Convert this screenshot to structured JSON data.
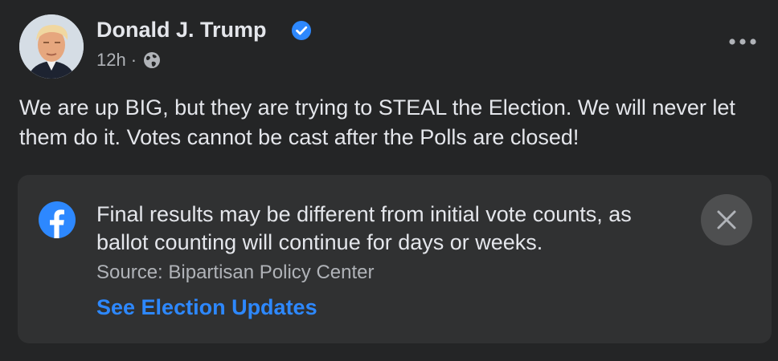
{
  "post": {
    "author_name": "Donald J. Trump",
    "verified_icon": "verified-badge-icon",
    "timestamp": "12h",
    "separator": "·",
    "privacy_icon": "globe-icon",
    "more_icon": "more-options-icon",
    "text": "We are up BIG, but they are trying to STEAL the Election. We will never let them do it. Votes cannot be cast after the Polls are closed!"
  },
  "label": {
    "icon": "facebook-logo-icon",
    "message": "Final results may be different from initial vote counts, as ballot counting will continue for days or weeks.",
    "source": "Source: Bipartisan Policy Center",
    "link_text": "See Election Updates",
    "close_icon": "close-icon"
  },
  "colors": {
    "background": "#242526",
    "card": "#303132",
    "primary_text": "#e4e6eb",
    "secondary_text": "#b0b3b8",
    "link": "#2d88ff",
    "verified": "#2d88ff"
  }
}
